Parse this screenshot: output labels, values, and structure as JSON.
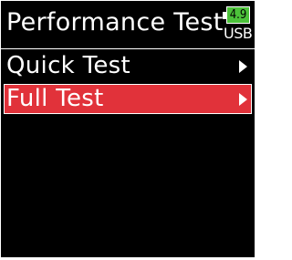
{
  "header": {
    "title": "Performance Test",
    "battery_level": "4.9",
    "power_source": "USB",
    "battery_color": "#4cc23a"
  },
  "menu": {
    "items": [
      {
        "label": "Quick Test",
        "icon": "chevron-right-icon",
        "selected": false
      },
      {
        "label": "Full Test",
        "icon": "chevron-right-icon",
        "selected": true
      }
    ],
    "highlight_color": "#e1323a"
  }
}
